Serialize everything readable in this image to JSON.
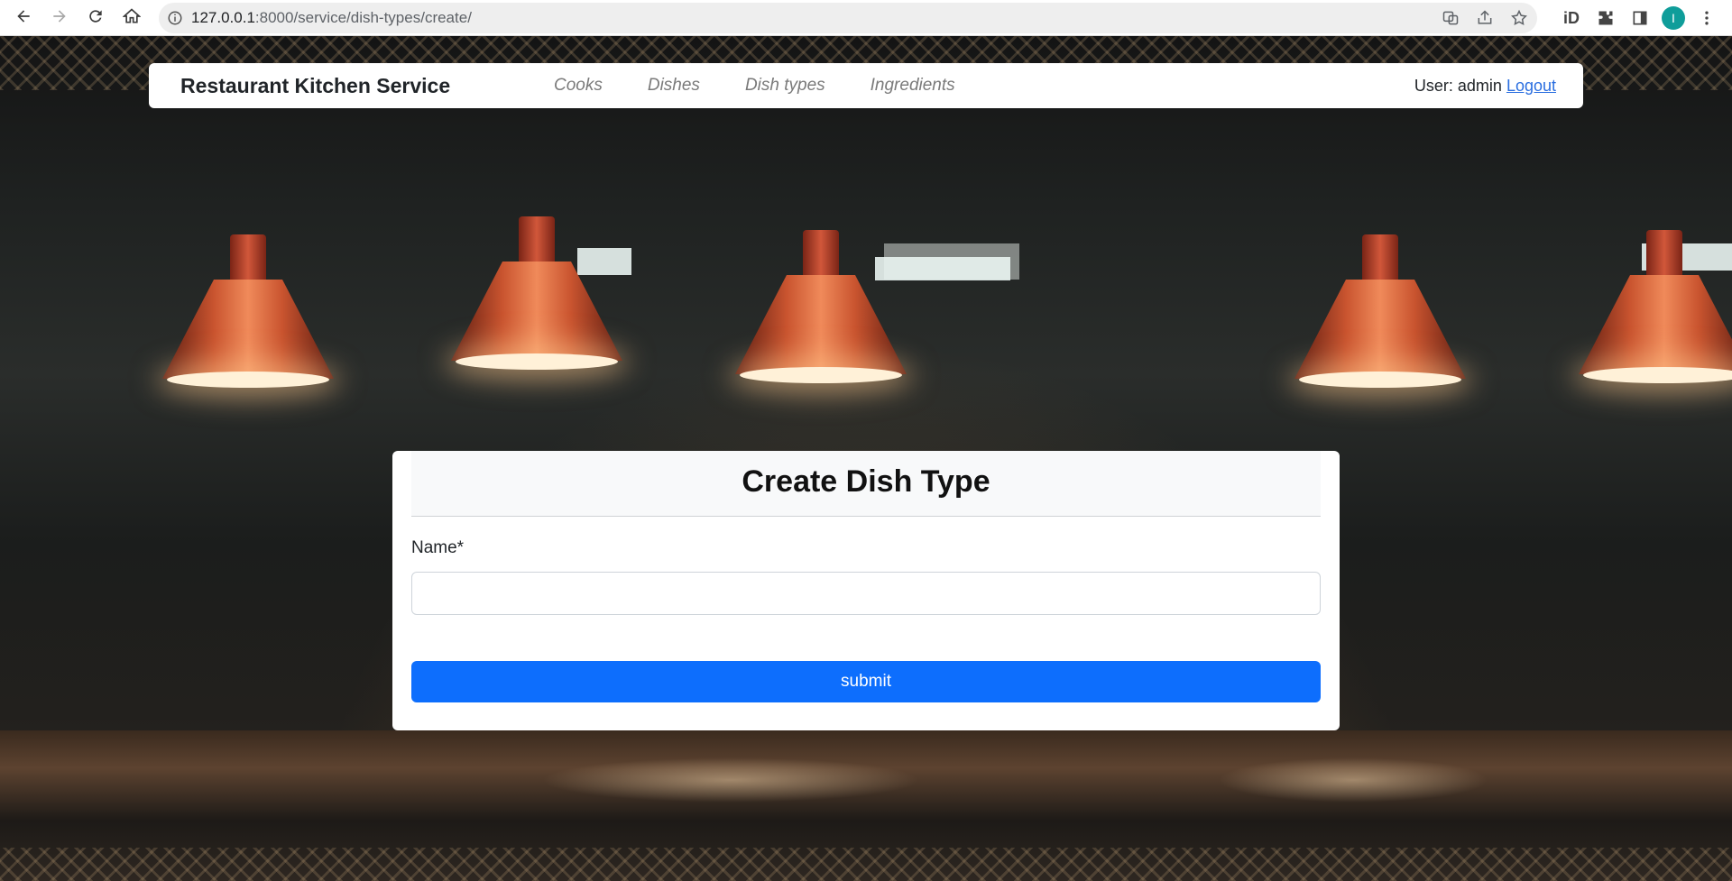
{
  "browser": {
    "url_host": "127.0.0.1",
    "url_path": ":8000/service/dish-types/create/",
    "profile_initial": "I",
    "extension_label": "iD"
  },
  "navbar": {
    "brand": "Restaurant Kitchen Service",
    "links": [
      "Cooks",
      "Dishes",
      "Dish types",
      "Ingredients"
    ],
    "user_prefix": "User: admin",
    "logout_label": "Logout"
  },
  "form": {
    "title": "Create Dish Type",
    "name_label": "Name*",
    "name_value": "",
    "submit_label": "submit"
  },
  "colors": {
    "primary": "#0d6efd",
    "link": "#2a6ee0",
    "avatar": "#0f9d9a"
  },
  "icons": [
    "back-arrow-icon",
    "forward-arrow-icon",
    "reload-icon",
    "home-icon",
    "info-icon",
    "translate-icon",
    "share-icon",
    "star-icon",
    "puzzle-icon",
    "sidebar-icon",
    "menu-dots-icon"
  ]
}
